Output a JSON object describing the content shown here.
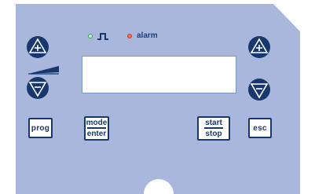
{
  "panel": {
    "colors": {
      "panel_fill": "#a9b7dd",
      "button_dark": "#18386d",
      "lcd_fill": "#ffffff",
      "led_green": "#2fa84f",
      "led_red": "#ff6b55"
    }
  },
  "indicators": {
    "pulse_icon": "square-wave-icon",
    "alarm_label": "alarm"
  },
  "keys": {
    "prog": "prog",
    "mode": "mode",
    "enter": "enter",
    "start": "start",
    "stop": "stop",
    "esc": "esc"
  },
  "round_buttons": {
    "left_up": "plus-up-icon",
    "left_down": "minus-down-icon",
    "right_up": "plus-up-icon",
    "right_down": "minus-down-icon",
    "ramp": "ramp-wedge-icon"
  }
}
